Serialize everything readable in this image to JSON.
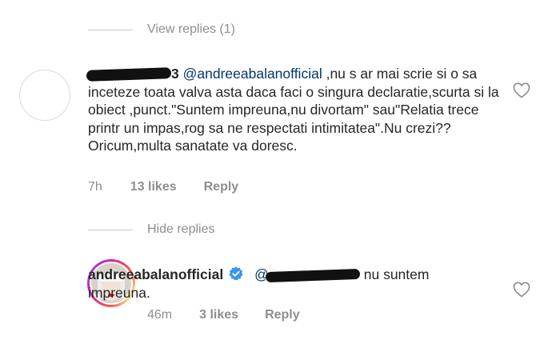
{
  "threads": {
    "view_replies_label": "View replies (1)",
    "hide_replies_label": "Hide replies"
  },
  "comment1": {
    "username_visible_suffix": "3",
    "mention": "@andreeabalanofficial",
    "text_line1": " ,nu s ar mai scrie",
    "text_rest": "si o sa inceteze toata valva asta daca faci o singura declaratie,scurta si la obiect ,punct.\"Suntem impreuna,nu divortam\" sau\"Relatia trece printr un impas,rog sa ne respectati intimitatea\".Nu crezi?? Oricum,multa sanatate va doresc.",
    "time": "7h",
    "likes": "13 likes",
    "reply_label": "Reply"
  },
  "comment2": {
    "username": "andreeabalanofficial",
    "mention_prefix": "@",
    "text_after_redaction": "nu suntem",
    "text_line2": "impreuna.",
    "time": "46m",
    "likes": "3 likes",
    "reply_label": "Reply"
  },
  "icons": {
    "heart": "heart-outline-icon",
    "verified": "verified-badge-icon"
  },
  "colors": {
    "muted": "#8e8e8e",
    "text": "#262626",
    "mention": "#00376b",
    "verified": "#3897f0"
  }
}
